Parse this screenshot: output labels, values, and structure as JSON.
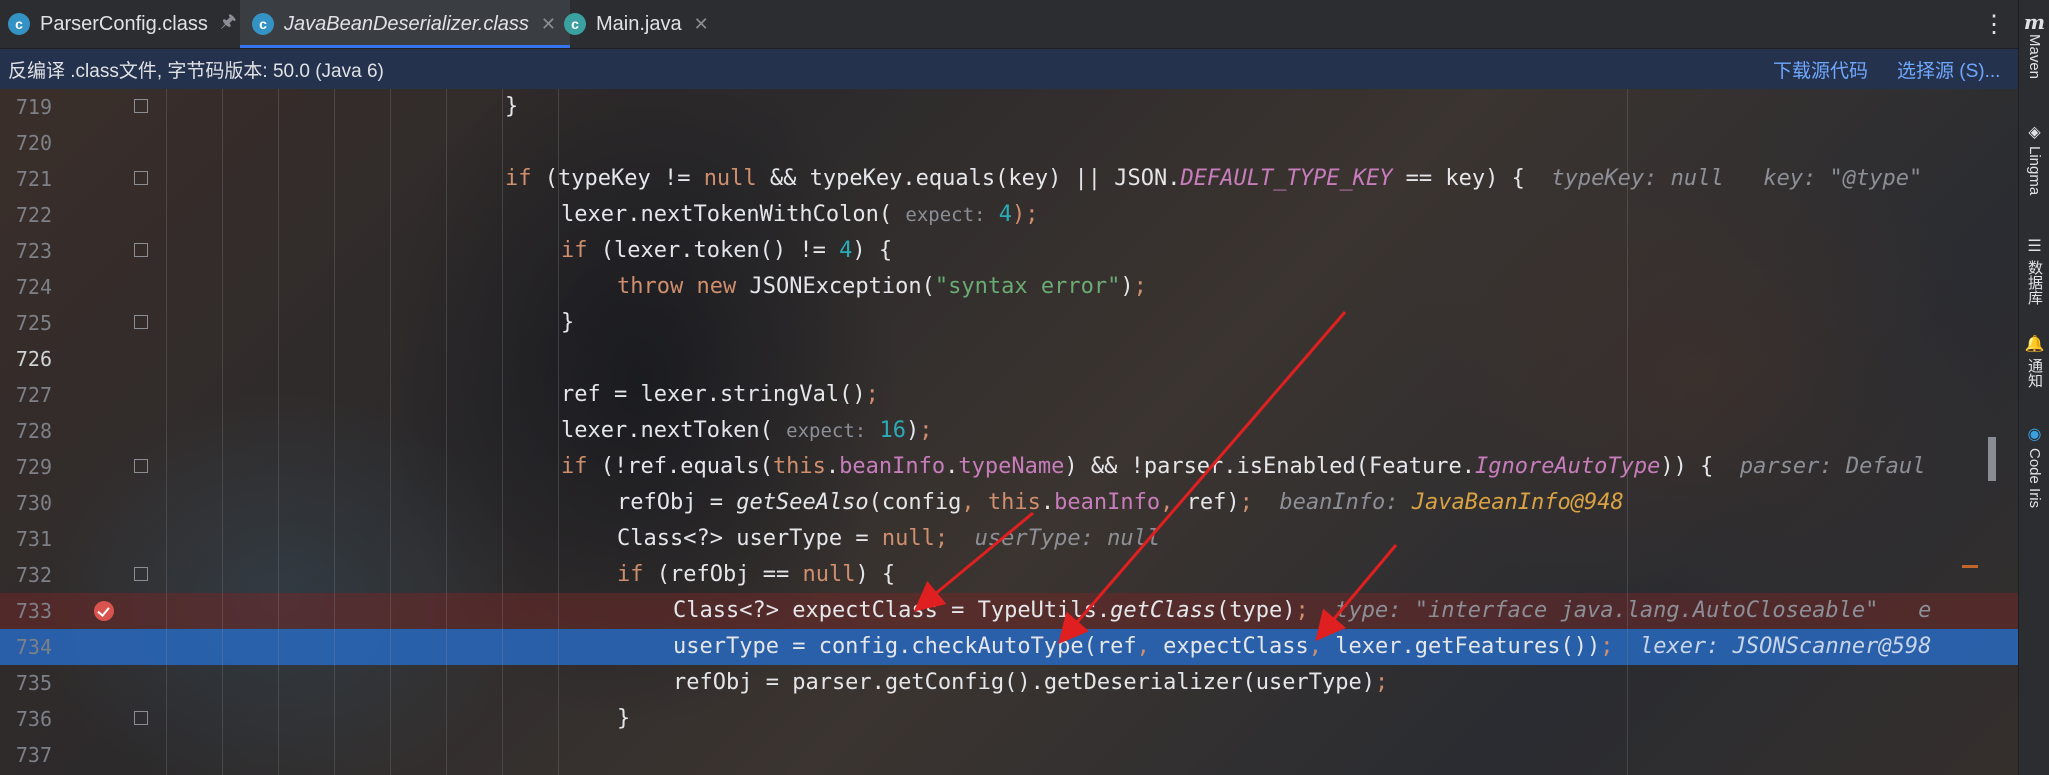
{
  "tabs": [
    {
      "label": "ParserConfig.class",
      "icon": "class-icon",
      "close": "pin-icon"
    },
    {
      "label": "JavaBeanDeserializer.class",
      "icon": "class-icon",
      "close": "close-icon",
      "active": true
    },
    {
      "label": "Main.java",
      "icon": "java-class-icon",
      "close": "close-icon"
    }
  ],
  "banner": {
    "text": "反编译 .class文件, 字节码版本: 50.0 (Java 6)",
    "download_link": "下载源代码",
    "choose_source_link": "选择源 (S)..."
  },
  "sidebar": {
    "maven": "Maven",
    "lingma": "Lingma",
    "database": "数据库",
    "notifications": "通知",
    "code_iris": "Code Iris"
  },
  "code_lines": [
    {
      "n": "719"
    },
    {
      "n": "720"
    },
    {
      "n": "721"
    },
    {
      "n": "722"
    },
    {
      "n": "723"
    },
    {
      "n": "724"
    },
    {
      "n": "725"
    },
    {
      "n": "726"
    },
    {
      "n": "727"
    },
    {
      "n": "728"
    },
    {
      "n": "729"
    },
    {
      "n": "730"
    },
    {
      "n": "731"
    },
    {
      "n": "732"
    },
    {
      "n": "733"
    },
    {
      "n": "734"
    },
    {
      "n": "735"
    },
    {
      "n": "736"
    },
    {
      "n": "737"
    }
  ],
  "code": {
    "l721_hint_typekey": "typeKey: null",
    "l721_hint_key": "key: \"@type\"",
    "l722_param": "expect:",
    "l722_val": "4",
    "l724_str": "\"syntax error\"",
    "l728_param": "expect:",
    "l728_val": "16",
    "l729_hint": "parser: Defaul",
    "l730_hint_label": "beanInfo:",
    "l730_hint_value": "JavaBeanInfo@948",
    "l731_hint": "userType: null",
    "l733_hint": "type: \"interface java.lang.AutoCloseable\"",
    "l733_hint2": "e",
    "l734_hint": "lexer: JSONScanner@598"
  },
  "colors": {
    "keyword": "#cf8e6d",
    "string": "#6aab73",
    "number": "#2aacb8",
    "field": "#c77dbb",
    "current_line": "#2a69be",
    "breakpoint": "#d9534f",
    "annotation_arrow": "#e02020"
  }
}
